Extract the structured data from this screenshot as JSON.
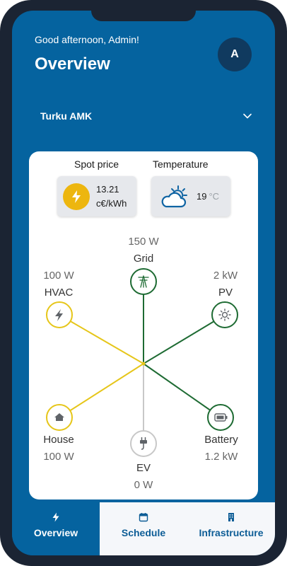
{
  "header": {
    "greeting": "Good afternoon, Admin!",
    "title": "Overview",
    "avatar_initial": "A"
  },
  "site_selector": {
    "selected": "Turku AMK",
    "icon": "chevron-down-icon"
  },
  "metrics": {
    "spot_price": {
      "title": "Spot price",
      "value": "13.21",
      "unit": "c€/kWh",
      "icon": "lightning-bolt-icon"
    },
    "temperature": {
      "title": "Temperature",
      "value": "19",
      "unit": "°C",
      "icon": "partly-cloudy-icon"
    }
  },
  "energy_flow": {
    "nodes": {
      "grid": {
        "label": "Grid",
        "value": "150 W",
        "icon": "transmission-tower-icon"
      },
      "hvac": {
        "label": "HVAC",
        "value": "100 W",
        "icon": "lightning-bolt-icon"
      },
      "pv": {
        "label": "PV",
        "value": "2 kW",
        "icon": "sun-icon"
      },
      "house": {
        "label": "House",
        "value": "100 W",
        "icon": "house-icon"
      },
      "ev": {
        "label": "EV",
        "value": "0 W",
        "icon": "plug-icon"
      },
      "battery": {
        "label": "Battery",
        "value": "1.2 kW",
        "icon": "battery-icon"
      }
    },
    "colors": {
      "consumption": "#e6c61a",
      "production": "#1e6b33",
      "idle": "#c8c8c8"
    }
  },
  "tabs": [
    {
      "label": "Overview",
      "icon": "lightning-bolt-icon",
      "active": true
    },
    {
      "label": "Schedule",
      "icon": "calendar-icon",
      "active": false
    },
    {
      "label": "Infrastructure",
      "icon": "building-icon",
      "active": false
    }
  ]
}
